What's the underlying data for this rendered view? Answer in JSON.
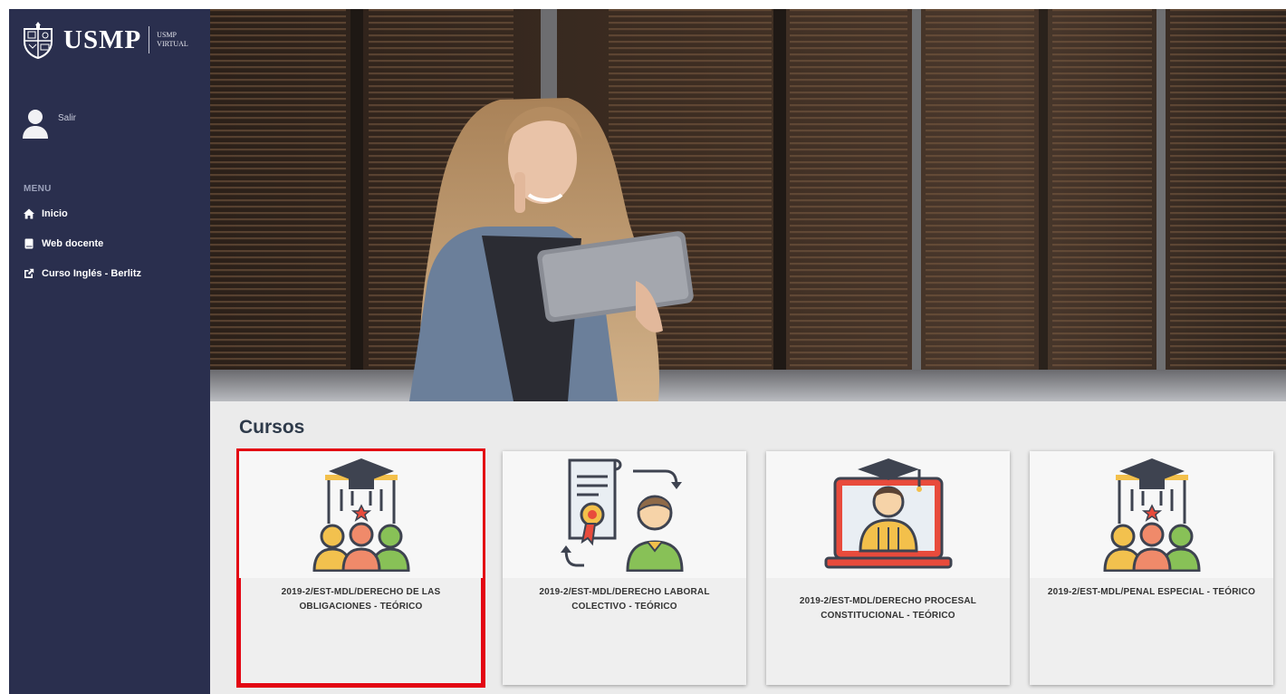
{
  "sidebar": {
    "brand": "USMP",
    "brand_sub": [
      "USMP",
      "VIRTUAL"
    ],
    "user_action": "Salir",
    "menu_title": "MENU",
    "items": [
      {
        "label": "Inicio",
        "icon": "home-icon"
      },
      {
        "label": "Web docente",
        "icon": "book-icon"
      },
      {
        "label": "Curso Inglés - Berlitz",
        "icon": "external-link-icon"
      }
    ]
  },
  "main": {
    "section_title": "Cursos",
    "courses": [
      {
        "title": "2019-2/EST-MDL/DERECHO DE LAS OBLIGACIONES - TEÓRICO",
        "icon": "graduation-group-icon",
        "selected": true
      },
      {
        "title": "2019-2/EST-MDL/DERECHO LABORAL COLECTIVO - TEÓRICO",
        "icon": "certificate-person-icon",
        "selected": false
      },
      {
        "title": "2019-2/EST-MDL/DERECHO PROCESAL CONSTITUCIONAL - TEÓRICO",
        "icon": "online-graduate-icon",
        "selected": false
      },
      {
        "title": "2019-2/EST-MDL/PENAL ESPECIAL - TEÓRICO",
        "icon": "graduation-group-icon",
        "selected": false
      }
    ]
  },
  "colors": {
    "sidebar_bg": "#2a2f4e",
    "selection_border": "#e30613",
    "content_bg": "#ebebeb"
  }
}
